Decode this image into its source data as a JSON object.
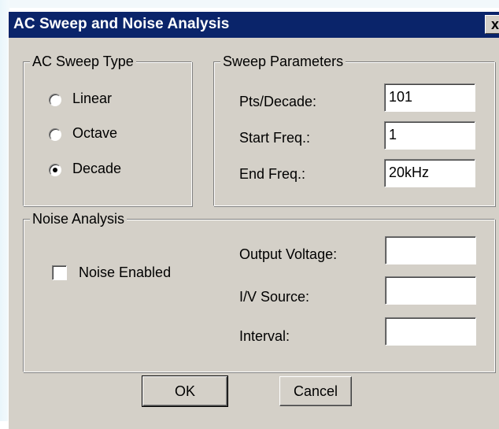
{
  "window": {
    "title": "AC Sweep and Noise Analysis",
    "close_glyph": "x"
  },
  "ac_sweep_type": {
    "legend": "AC Sweep Type",
    "options": [
      {
        "label": "Linear",
        "selected": false
      },
      {
        "label": "Octave",
        "selected": false
      },
      {
        "label": "Decade",
        "selected": true
      }
    ]
  },
  "sweep_parameters": {
    "legend": "Sweep Parameters",
    "pts_label": "Pts/Decade:",
    "pts_value": "101",
    "start_label": "Start Freq.:",
    "start_value": "1",
    "end_label": "End Freq.:",
    "end_value": "20kHz"
  },
  "noise_analysis": {
    "legend": "Noise Analysis",
    "enabled_label": "Noise Enabled",
    "enabled_checked": false,
    "output_voltage_label": "Output Voltage:",
    "output_voltage_value": "",
    "iv_source_label": "I/V Source:",
    "iv_source_value": "",
    "interval_label": "Interval:",
    "interval_value": ""
  },
  "buttons": {
    "ok": "OK",
    "cancel": "Cancel"
  }
}
